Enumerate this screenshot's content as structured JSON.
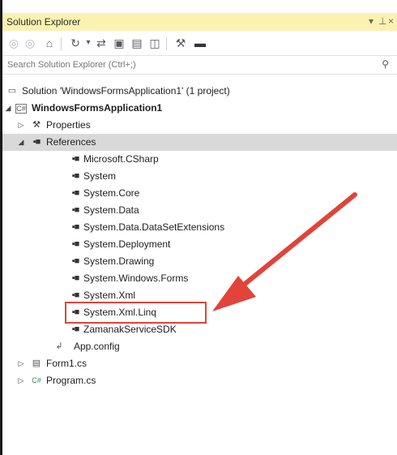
{
  "panel": {
    "title": "Solution Explorer",
    "title_controls": [
      "▾",
      "⊥",
      "×"
    ]
  },
  "toolbar": {
    "buttons": [
      "back-icon",
      "forward-icon",
      "home-icon",
      "history-icon",
      "sync-icon",
      "collapse-icon",
      "properties-icon",
      "show-all-icon",
      "wrench-icon",
      "pin-icon"
    ]
  },
  "search": {
    "placeholder": "Search Solution Explorer (Ctrl+;)"
  },
  "tree": {
    "solution": "Solution 'WindowsFormsApplication1' (1 project)",
    "project": "WindowsFormsApplication1",
    "properties": "Properties",
    "references": "References",
    "reference_items": [
      "Microsoft.CSharp",
      "System",
      "System.Core",
      "System.Data",
      "System.Data.DataSetExtensions",
      "System.Deployment",
      "System.Drawing",
      "System.Windows.Forms",
      "System.Xml",
      "System.Xml.Linq",
      "ZamanakServiceSDK"
    ],
    "app_config": "App.config",
    "form1": "Form1.cs",
    "program": "Program.cs"
  },
  "colors": {
    "titlebar": "#fbf2b2",
    "selection": "#d9d9d9",
    "annotation_red": "#e0443a"
  }
}
